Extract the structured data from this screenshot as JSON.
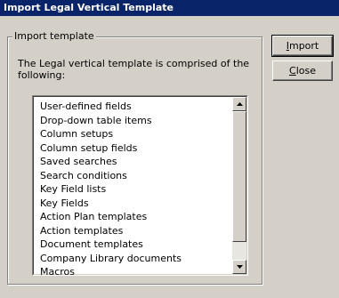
{
  "window": {
    "title": "Import Legal Vertical Template"
  },
  "group": {
    "legend": "Import template",
    "description": "The Legal vertical template is comprised of the following:"
  },
  "list": {
    "items": [
      "User-defined fields",
      "Drop-down table items",
      "Column setups",
      "Column setup fields",
      "Saved searches",
      "Search conditions",
      "Key Field lists",
      "Key Fields",
      "Action Plan templates",
      "Action templates",
      "Document templates",
      "Company Library documents",
      "Macros"
    ]
  },
  "buttons": {
    "import_mnemonic": "I",
    "import_rest": "mport",
    "close_mnemonic": "C",
    "close_rest": "lose"
  },
  "colors": {
    "titlebar": "#0a246a",
    "face": "#d4d0c8"
  }
}
